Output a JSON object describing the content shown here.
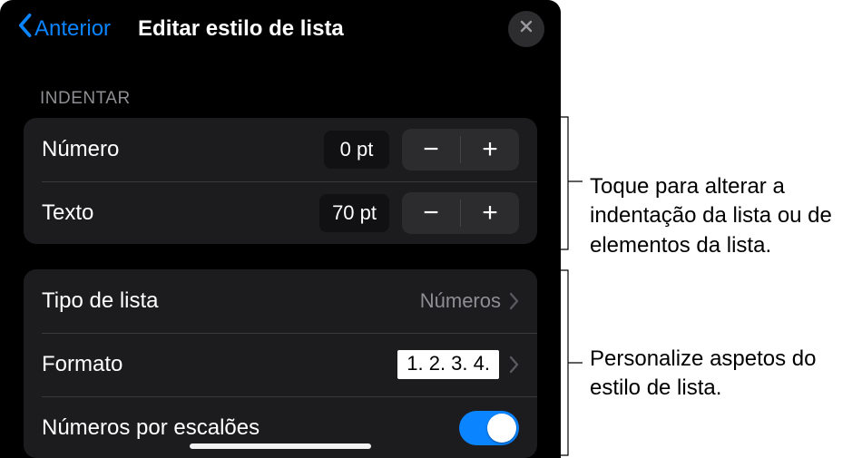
{
  "header": {
    "back_label": "Anterior",
    "title": "Editar estilo de lista"
  },
  "sections": {
    "indent": {
      "label": "Indentar",
      "number_label": "Número",
      "number_value": "0 pt",
      "text_label": "Texto",
      "text_value": "70 pt"
    },
    "style": {
      "list_type_label": "Tipo de lista",
      "list_type_value": "Números",
      "format_label": "Formato",
      "format_preview": "1. 2. 3. 4.",
      "tiered_label": "Números por escalões"
    }
  },
  "annotations": {
    "a1": "Toque para alterar a indentação da lista ou de elementos da lista.",
    "a2": "Personalize aspetos do estilo de lista."
  },
  "icons": {
    "minus": "−",
    "plus": "+"
  }
}
